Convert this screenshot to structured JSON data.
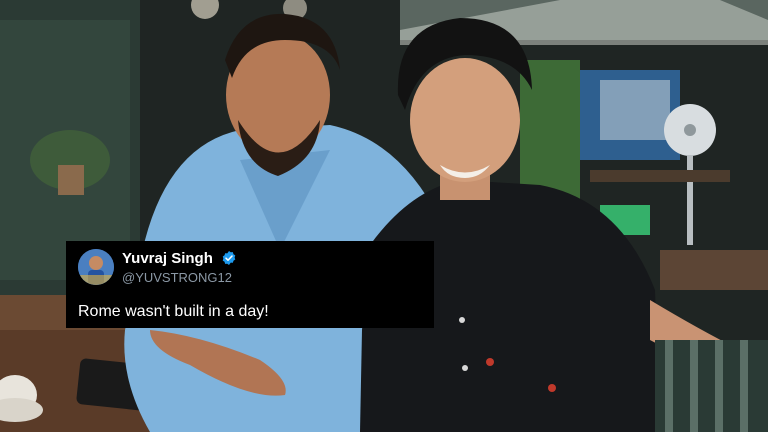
{
  "tweet": {
    "display_name": "Yuvraj Singh",
    "handle": "@YUVSTRONG12",
    "text": "Rome wasn't built in a day!",
    "verified_icon": "verified-badge-icon",
    "verified_color": "#1d9bf0"
  },
  "colors": {
    "card_background": "#000000",
    "handle_color": "#8b98a5"
  }
}
